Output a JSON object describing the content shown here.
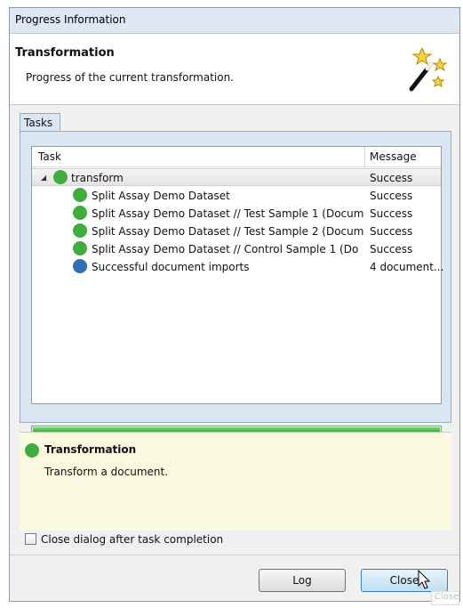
{
  "window": {
    "title": "Progress Information"
  },
  "header": {
    "title": "Transformation",
    "description": "Progress of the current transformation."
  },
  "tabs": [
    {
      "label": "Tasks"
    }
  ],
  "table": {
    "columns": [
      "Task",
      "Message"
    ],
    "rows": [
      {
        "task": "transform",
        "message": "Success",
        "icon": "check-icon",
        "level": 0,
        "expanded": true
      },
      {
        "task": "Split Assay Demo Dataset",
        "message": "Success",
        "icon": "check-icon",
        "level": 1
      },
      {
        "task": "Split Assay Demo Dataset // Test Sample 1 (Docum",
        "message": "Success",
        "icon": "check-icon",
        "level": 1
      },
      {
        "task": "Split Assay Demo Dataset // Test Sample 2 (Docum",
        "message": "Success",
        "icon": "check-icon",
        "level": 1
      },
      {
        "task": "Split Assay Demo Dataset // Control Sample 1 (Do",
        "message": "Success",
        "icon": "check-icon",
        "level": 1
      },
      {
        "task": "Successful document imports",
        "message": "4 document...",
        "icon": "info-icon",
        "level": 1
      }
    ]
  },
  "progress": {
    "value": 1.0,
    "color": "#34a834"
  },
  "detail": {
    "title": "Transformation",
    "description": "Transform a document."
  },
  "checkbox": {
    "label": "Close dialog after task completion",
    "checked": false
  },
  "buttons": {
    "log": "Log",
    "close": "Close"
  },
  "tooltip": {
    "text": "Close"
  },
  "colors": {
    "title_bar": "#dde8f4",
    "detail_bg": "#fbfae0",
    "success": "#3fae3f",
    "info": "#2f6fb6"
  }
}
